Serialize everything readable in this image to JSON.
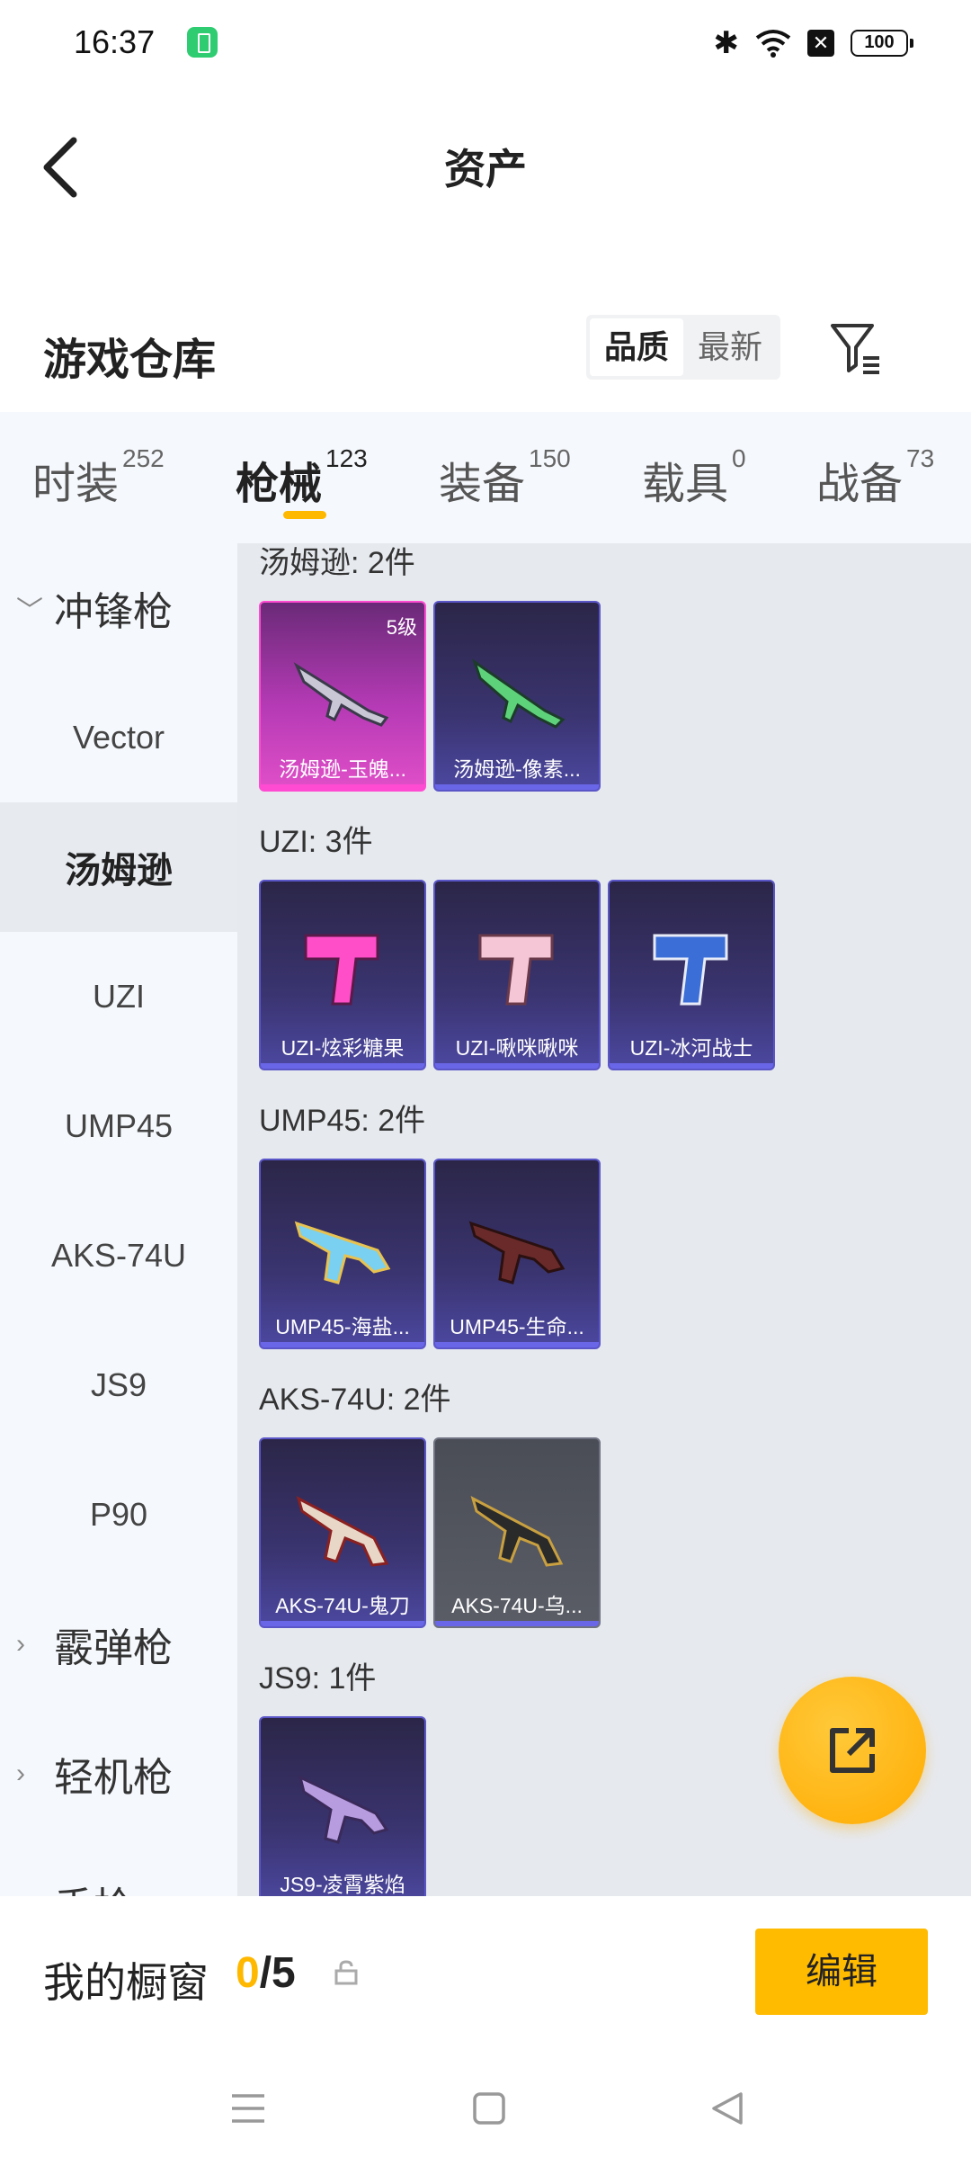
{
  "status_bar": {
    "time": "16:37",
    "battery": "100",
    "sim_label": "✕"
  },
  "header": {
    "title": "资产"
  },
  "section": {
    "title": "游戏仓库",
    "sort_options": [
      "品质",
      "最新"
    ]
  },
  "tabs": [
    {
      "label": "时装",
      "count": "252"
    },
    {
      "label": "枪械",
      "count": "123"
    },
    {
      "label": "装备",
      "count": "150"
    },
    {
      "label": "载具",
      "count": "0"
    },
    {
      "label": "战备",
      "count": "73"
    }
  ],
  "sidebar": {
    "groups": [
      "冲锋枪",
      "霰弹枪",
      "轻机枪",
      "手枪"
    ],
    "items": [
      "Vector",
      "汤姆逊",
      "UZI",
      "UMP45",
      "AKS-74U",
      "JS9",
      "P90"
    ],
    "selected": "汤姆逊"
  },
  "content": {
    "groups": [
      {
        "label": "汤姆逊: 2件",
        "items": [
          {
            "name": "汤姆逊-玉魄...",
            "level": "5级",
            "rarity": "legendary"
          },
          {
            "name": "汤姆逊-像素...",
            "rarity": "epic"
          }
        ]
      },
      {
        "label": "UZI: 3件",
        "items": [
          {
            "name": "UZI-炫彩糖果",
            "rarity": "epic"
          },
          {
            "name": "UZI-啾咪啾咪",
            "rarity": "epic"
          },
          {
            "name": "UZI-冰河战士",
            "rarity": "epic"
          }
        ]
      },
      {
        "label": "UMP45: 2件",
        "items": [
          {
            "name": "UMP45-海盐...",
            "rarity": "epic"
          },
          {
            "name": "UMP45-生命...",
            "rarity": "epic"
          }
        ]
      },
      {
        "label": "AKS-74U: 2件",
        "items": [
          {
            "name": "AKS-74U-鬼刀",
            "rarity": "epic"
          },
          {
            "name": "AKS-74U-乌...",
            "rarity": "common"
          }
        ]
      },
      {
        "label": "JS9: 1件",
        "items": [
          {
            "name": "JS9-凌霄紫焰",
            "rarity": "epic"
          }
        ]
      }
    ]
  },
  "bottom": {
    "showcase_label": "我的橱窗",
    "current": "0",
    "slash": "/",
    "total": "5",
    "edit_label": "编辑"
  },
  "colors": {
    "accent": "#ffb800",
    "epic": "#5b56c8",
    "legendary": "#ff4bd2"
  }
}
